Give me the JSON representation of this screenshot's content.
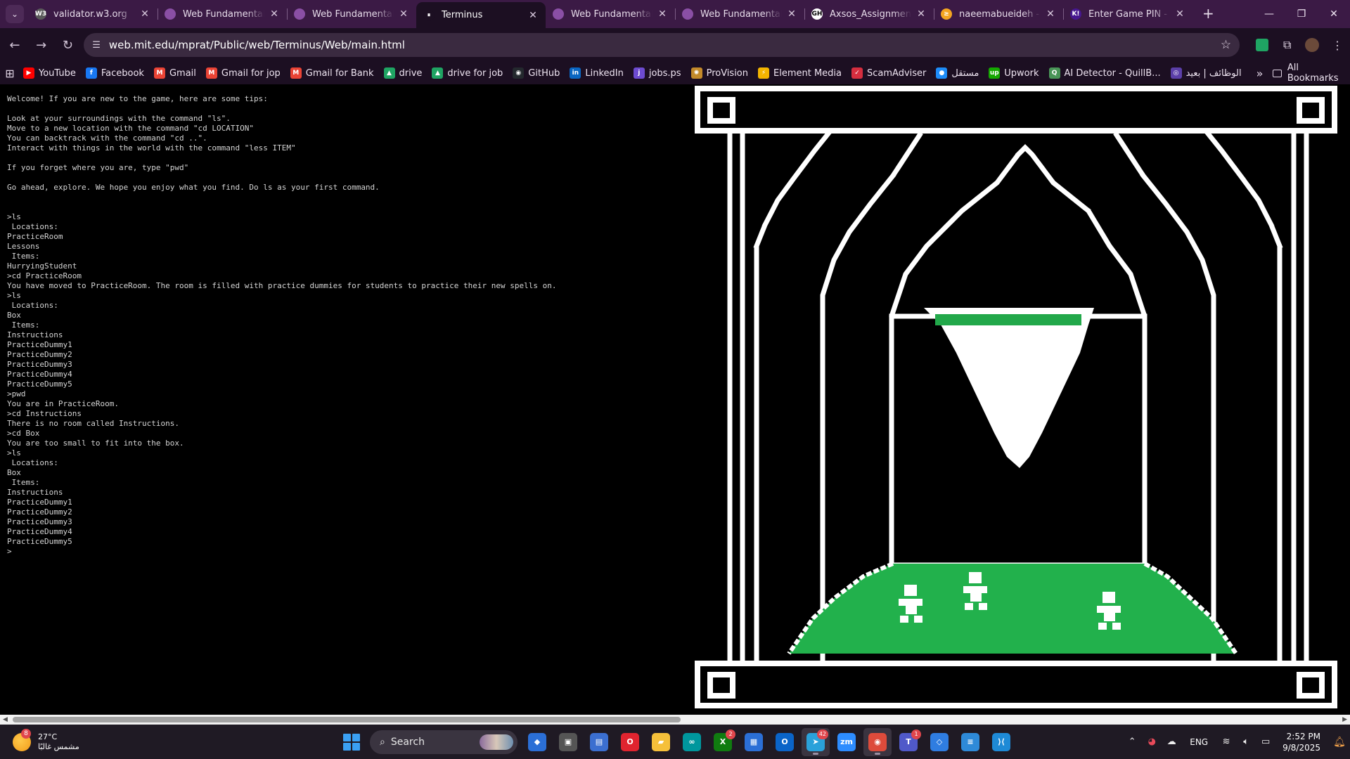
{
  "browser": {
    "tabs": [
      {
        "title": "validator.w3.org",
        "favicon_color": "#5a5a5a",
        "favicon_text": "W3"
      },
      {
        "title": "Web Fundamentals o",
        "favicon_color": "#8a4fa5",
        "favicon_text": ""
      },
      {
        "title": "Web Fundamentals o",
        "favicon_color": "#8a4fa5",
        "favicon_text": ""
      },
      {
        "title": "Terminus",
        "favicon_color": "#1c0f22",
        "favicon_text": "⏸",
        "active": true
      },
      {
        "title": "Web Fundamentals o",
        "favicon_color": "#8a4fa5",
        "favicon_text": ""
      },
      {
        "title": "Web Fundamentals o",
        "favicon_color": "#8a4fa5",
        "favicon_text": ""
      },
      {
        "title": "Axsos_Assignments/V",
        "favicon_color": "#ffffff",
        "favicon_text": "GH"
      },
      {
        "title": "naeemabueideh - Le",
        "favicon_color": "#f4a521",
        "favicon_text": "≥"
      },
      {
        "title": "Enter Game PIN - Ka",
        "favicon_color": "#46178f",
        "favicon_text": "K!"
      }
    ],
    "url": "web.mit.edu/mprat/Public/web/Terminus/Web/main.html",
    "bookmarks": [
      {
        "label": "YouTube",
        "color": "#ff0000",
        "glyph": "▶"
      },
      {
        "label": "Facebook",
        "color": "#1877f2",
        "glyph": "f"
      },
      {
        "label": "Gmail",
        "color": "#ea4335",
        "glyph": "M"
      },
      {
        "label": "Gmail for jop",
        "color": "#ea4335",
        "glyph": "M"
      },
      {
        "label": "Gmail for Bank",
        "color": "#ea4335",
        "glyph": "M"
      },
      {
        "label": "drive",
        "color": "#1fa463",
        "glyph": "▲"
      },
      {
        "label": "drive for job",
        "color": "#1fa463",
        "glyph": "▲"
      },
      {
        "label": "GitHub",
        "color": "#24292e",
        "glyph": "◉"
      },
      {
        "label": "LinkedIn",
        "color": "#0a66c2",
        "glyph": "in"
      },
      {
        "label": "jobs.ps",
        "color": "#6d4bd0",
        "glyph": "j"
      },
      {
        "label": "ProVision",
        "color": "#c48a2a",
        "glyph": "✺"
      },
      {
        "label": "Element Media",
        "color": "#f3b400",
        "glyph": "⚡"
      },
      {
        "label": "ScamAdviser",
        "color": "#d62e3f",
        "glyph": "✓"
      },
      {
        "label": "مستقل",
        "color": "#1d8cf8",
        "glyph": "●"
      },
      {
        "label": "Upwork",
        "color": "#14a800",
        "glyph": "up"
      },
      {
        "label": "AI Detector - QuillB...",
        "color": "#499557",
        "glyph": "Q"
      },
      {
        "label": "الوظائف | بعيد",
        "color": "#5b3fa8",
        "glyph": "◎"
      }
    ],
    "all_bookmarks_label": "All Bookmarks"
  },
  "terminal": {
    "lines": [
      "Welcome! If you are new to the game, here are some tips:",
      "",
      "Look at your surroundings with the command \"ls\".",
      "Move to a new location with the command \"cd LOCATION\"",
      "You can backtrack with the command \"cd ..\".",
      "Interact with things in the world with the command \"less ITEM\"",
      "",
      "If you forget where you are, type \"pwd\"",
      "",
      "Go ahead, explore. We hope you enjoy what you find. Do ls as your first command.",
      "",
      "",
      ">ls",
      " Locations:",
      "PracticeRoom",
      "Lessons",
      " Items:",
      "HurryingStudent",
      ">cd PracticeRoom",
      "You have moved to PracticeRoom. The room is filled with practice dummies for students to practice their new spells on.",
      ">ls",
      " Locations:",
      "Box",
      " Items:",
      "Instructions",
      "PracticeDummy1",
      "PracticeDummy2",
      "PracticeDummy3",
      "PracticeDummy4",
      "PracticeDummy5",
      ">pwd",
      "You are in PracticeRoom.",
      ">cd Instructions",
      "There is no room called Instructions.",
      ">cd Box",
      "You are too small to fit into the box.",
      ">ls",
      " Locations:",
      "Box",
      " Items:",
      "Instructions",
      "PracticeDummy1",
      "PracticeDummy2",
      "PracticeDummy3",
      "PracticeDummy4",
      "PracticeDummy5",
      ">"
    ]
  },
  "art": {
    "banner_color": "#22a84a",
    "floor_color": "#22b14c",
    "line_color": "#ffffff"
  },
  "taskbar": {
    "weather_temp": "27°C",
    "weather_desc": "مشمس غالبًا",
    "weather_badge": "8",
    "search_label": "Search",
    "apps": [
      {
        "name": "copilot",
        "color": "#2b6fd6",
        "glyph": "◆"
      },
      {
        "name": "task-view",
        "color": "#555",
        "glyph": "▣"
      },
      {
        "name": "notes",
        "color": "#3b6fd0",
        "glyph": "▤"
      },
      {
        "name": "opera",
        "color": "#e0242f",
        "glyph": "O"
      },
      {
        "name": "file-explorer",
        "color": "#f5c03a",
        "glyph": "▰"
      },
      {
        "name": "arduino",
        "color": "#00979d",
        "glyph": "∞"
      },
      {
        "name": "xbox",
        "color": "#107c10",
        "glyph": "X",
        "badge": "2"
      },
      {
        "name": "store",
        "color": "#2b6fd6",
        "glyph": "▦"
      },
      {
        "name": "outlook",
        "color": "#0a64c8",
        "glyph": "O"
      },
      {
        "name": "telegram",
        "color": "#2aa1da",
        "glyph": "➤",
        "badge": "42",
        "active": true
      },
      {
        "name": "zoom",
        "color": "#2d8cff",
        "glyph": "zm"
      },
      {
        "name": "chrome",
        "color": "#dd4b3b",
        "glyph": "◉",
        "active": true
      },
      {
        "name": "teams",
        "color": "#5059c9",
        "glyph": "T",
        "badge": "1"
      },
      {
        "name": "git",
        "color": "#2f7de1",
        "glyph": "◇"
      },
      {
        "name": "notepad",
        "color": "#2e8ad8",
        "glyph": "≡"
      },
      {
        "name": "vscode",
        "color": "#1e8ad6",
        "glyph": "⟩⟨"
      }
    ],
    "language": "ENG",
    "time": "2:52 PM",
    "date": "9/8/2025"
  }
}
